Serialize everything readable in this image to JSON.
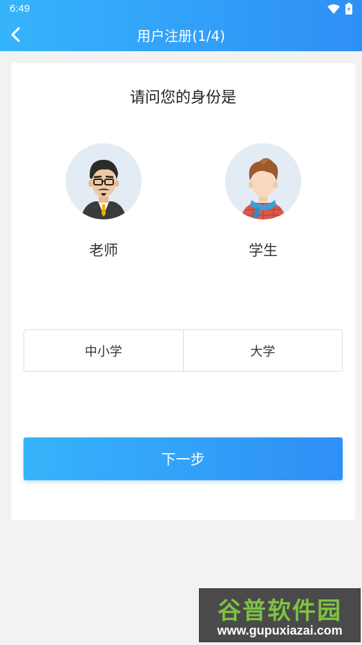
{
  "status_bar": {
    "time": "6:49",
    "wifi_icon": "wifi-icon",
    "battery_icon": "battery-icon"
  },
  "header": {
    "title": "用户注册(1/4)",
    "back_icon": "chevron-left-icon"
  },
  "question": "请问您的身份是",
  "roles": [
    {
      "label": "老师",
      "avatar_icon": "teacher-avatar-icon"
    },
    {
      "label": "学生",
      "avatar_icon": "student-avatar-icon"
    }
  ],
  "school_levels": [
    {
      "label": "中小学"
    },
    {
      "label": "大学"
    }
  ],
  "next_button": "下一步",
  "watermark": {
    "cn": "谷普软件园",
    "url": "www.gupuxiazai.com"
  },
  "colors": {
    "accent_start": "#36b4fb",
    "accent_end": "#2f8ff6",
    "background": "#f2f2f2",
    "avatar_bg": "#e3ebf4"
  }
}
